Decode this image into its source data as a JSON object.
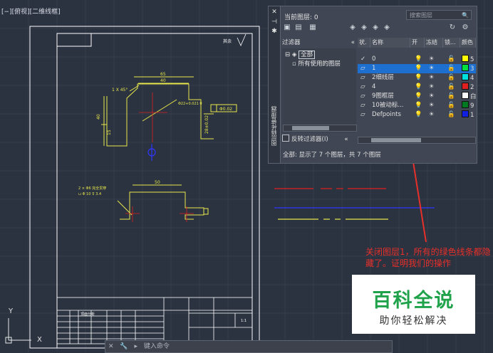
{
  "viewport": {
    "label": "[−][俯视][二维线框]"
  },
  "palette": {
    "drawing_yellow": "#e8e84a",
    "drawing_red": "#e02020",
    "drawing_blue": "#2f36ff",
    "frame_white": "#ffffff",
    "annotation_red": "#e8302a",
    "watermark_green": "#1fa24a"
  },
  "drawing": {
    "dims": {
      "top_width": "65",
      "inner_width": "40",
      "chamfer": "1 X 45°",
      "hole_tol": "Φ22+0.021\n     0",
      "flatness": "Φ0.02",
      "left_height": "40",
      "right_dim": "28±0.02",
      "small_dim": "15",
      "bottom_note1": "2 × Φ6 完全贯穿",
      "bottom_note2": "⊔ Φ 10 ⊽ 3.4",
      "bottom_dim": "50",
      "right_small": "15",
      "roughness": "其余"
    },
    "title_block": {
      "name": "顶面分析",
      "scale": "1:1"
    }
  },
  "layer_panel": {
    "current_layer": "当前图层: 0",
    "search_placeholder": "搜索图层",
    "filter_header": "过滤器",
    "tree": {
      "all": "全部",
      "used": "所有使用的图层"
    },
    "invert_filter": "反转过滤器(I)",
    "strip_title": "图层特性管理器",
    "columns": {
      "status": "状.",
      "name": "名称",
      "on": "开",
      "freeze": "冻结",
      "lock": "锁...",
      "color": "颜色"
    },
    "rows": [
      {
        "status": "✓",
        "name": "0",
        "color": "#ffff00",
        "color_label": "5",
        "selected": false
      },
      {
        "status": "▱",
        "name": "1",
        "color": "#00e040",
        "color_label": "3",
        "selected": true
      },
      {
        "status": "▱",
        "name": "2细线层",
        "color": "#00e0e0",
        "color_label": "4",
        "selected": false
      },
      {
        "status": "▱",
        "name": "4",
        "color": "#e02020",
        "color_label": "2",
        "selected": false
      },
      {
        "status": "▱",
        "name": "9图框层",
        "color": "#ffffff",
        "color_label": "白",
        "selected": false
      },
      {
        "status": "▱",
        "name": "10被动标...",
        "color": "#007a20",
        "color_label": "9",
        "selected": false
      },
      {
        "status": "▱",
        "name": "Defpoints",
        "color": "#1020e0",
        "color_label": "1",
        "selected": false
      }
    ],
    "status_text": "全部: 显示了 7 个图层，共 7 个图层"
  },
  "annotation": {
    "text": "关闭图层1，所有的绿色线条都隐藏了。证明我们的操作"
  },
  "watermark": {
    "title": "百科全说",
    "subtitle": "助你轻松解决"
  },
  "command_line": {
    "placeholder": "键入命令"
  },
  "ucs": {
    "x": "X",
    "y": "Y"
  }
}
